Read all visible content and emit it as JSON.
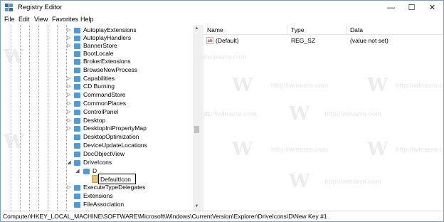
{
  "window": {
    "title": "Registry Editor",
    "controls": {
      "minimize": "—",
      "maximize": "☐",
      "close": "✕"
    }
  },
  "menu": [
    "File",
    "Edit",
    "View",
    "Favorites",
    "Help"
  ],
  "tree": {
    "items": [
      {
        "label": "AutoplayExtensions",
        "expander": "▷"
      },
      {
        "label": "AutoplayHandlers",
        "expander": "▷"
      },
      {
        "label": "BannerStore",
        "expander": "▷"
      },
      {
        "label": "BootLocale",
        "expander": ""
      },
      {
        "label": "BrokerExtensions",
        "expander": ""
      },
      {
        "label": "BrowseNewProcess",
        "expander": ""
      },
      {
        "label": "Capabilities",
        "expander": "▷"
      },
      {
        "label": "CD Burning",
        "expander": "▷"
      },
      {
        "label": "CommandStore",
        "expander": "▷"
      },
      {
        "label": "CommonPlaces",
        "expander": "▷"
      },
      {
        "label": "ControlPanel",
        "expander": "▷"
      },
      {
        "label": "Desktop",
        "expander": "▷"
      },
      {
        "label": "DesktopIniPropertyMap",
        "expander": "▷"
      },
      {
        "label": "DesktopOptimization",
        "expander": ""
      },
      {
        "label": "DeviceUpdateLocations",
        "expander": ""
      },
      {
        "label": "DocObjectView",
        "expander": ""
      },
      {
        "label": "DriveIcons",
        "expander": "◢"
      },
      {
        "label": "D",
        "expander": "◢"
      },
      {
        "label": "DefaultIcon",
        "expander": ""
      },
      {
        "label": "ExecuteTypeDelegates",
        "expander": "▷"
      },
      {
        "label": "Extensions",
        "expander": ""
      },
      {
        "label": "FileAssociation",
        "expander": ""
      }
    ]
  },
  "list": {
    "columns": {
      "name": "Name",
      "type": "Type",
      "data": "Data"
    },
    "rows": [
      {
        "icon": "ab",
        "name": "(Default)",
        "type": "REG_SZ",
        "data": "(value not set)"
      }
    ]
  },
  "watermark": {
    "letter": "W",
    "text": "http://winaero.com"
  },
  "status": "Computer\\HKEY_LOCAL_MACHINE\\SOFTWARE\\Microsoft\\Windows\\CurrentVersion\\Explorer\\DriveIcons\\D\\New Key #1",
  "colors": {
    "folder": "#4f9bd9",
    "folder_open": "#e9c46a",
    "border": "#7a9fc7"
  }
}
